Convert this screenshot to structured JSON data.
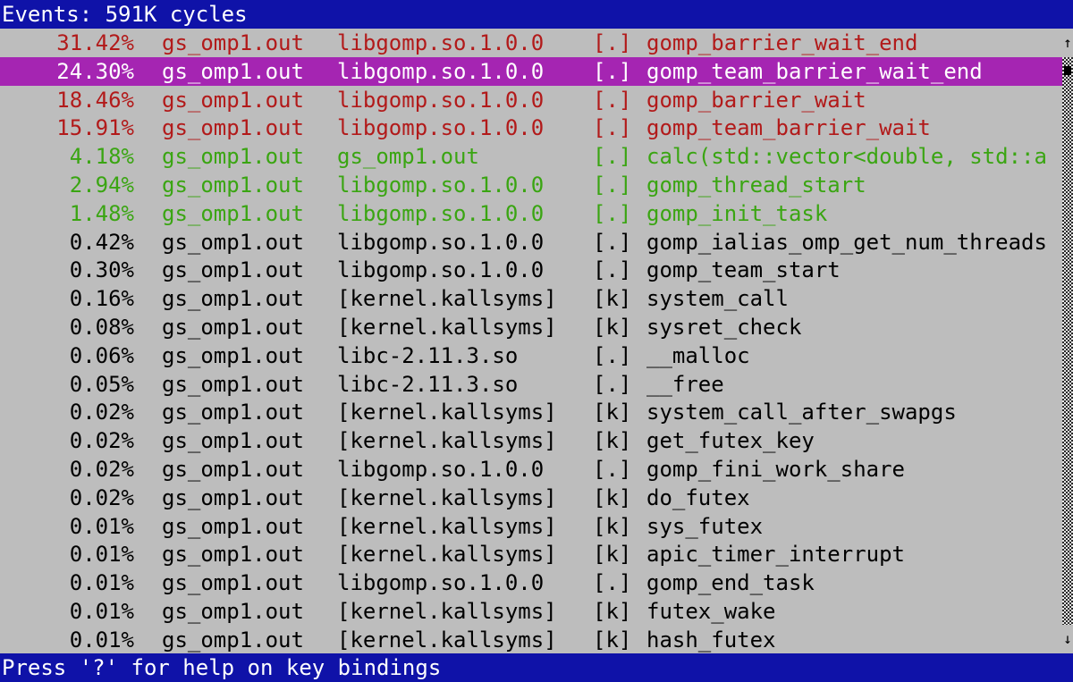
{
  "header": {
    "title": "Events: 591K cycles"
  },
  "footer": {
    "hint": "Press '?' for help on key bindings"
  },
  "colors": {
    "bar_bg": "#0f12a8",
    "selection_bg": "#a525b2",
    "hot": "#b21a1a",
    "warm": "#3aa512",
    "background": "#bdbdbd"
  },
  "scrollbar": {
    "up_icon": "↑",
    "down_icon": "↓"
  },
  "rows": [
    {
      "pct": "31.42%",
      "command": "gs_omp1.out",
      "dso": "libgomp.so.1.0.0",
      "level": "[.]",
      "symbol": "gomp_barrier_wait_end",
      "heat": "red",
      "selected": false
    },
    {
      "pct": "24.30%",
      "command": "gs_omp1.out",
      "dso": "libgomp.so.1.0.0",
      "level": "[.]",
      "symbol": "gomp_team_barrier_wait_end",
      "heat": "red",
      "selected": true
    },
    {
      "pct": "18.46%",
      "command": "gs_omp1.out",
      "dso": "libgomp.so.1.0.0",
      "level": "[.]",
      "symbol": "gomp_barrier_wait",
      "heat": "red",
      "selected": false
    },
    {
      "pct": "15.91%",
      "command": "gs_omp1.out",
      "dso": "libgomp.so.1.0.0",
      "level": "[.]",
      "symbol": "gomp_team_barrier_wait",
      "heat": "red",
      "selected": false
    },
    {
      "pct": "4.18%",
      "command": "gs_omp1.out",
      "dso": "gs_omp1.out",
      "level": "[.]",
      "symbol": "calc(std::vector<double, std::a",
      "heat": "green",
      "selected": false
    },
    {
      "pct": "2.94%",
      "command": "gs_omp1.out",
      "dso": "libgomp.so.1.0.0",
      "level": "[.]",
      "symbol": "gomp_thread_start",
      "heat": "green",
      "selected": false
    },
    {
      "pct": "1.48%",
      "command": "gs_omp1.out",
      "dso": "libgomp.so.1.0.0",
      "level": "[.]",
      "symbol": "gomp_init_task",
      "heat": "green",
      "selected": false
    },
    {
      "pct": "0.42%",
      "command": "gs_omp1.out",
      "dso": "libgomp.so.1.0.0",
      "level": "[.]",
      "symbol": "gomp_ialias_omp_get_num_threads",
      "heat": "none",
      "selected": false
    },
    {
      "pct": "0.30%",
      "command": "gs_omp1.out",
      "dso": "libgomp.so.1.0.0",
      "level": "[.]",
      "symbol": "gomp_team_start",
      "heat": "none",
      "selected": false
    },
    {
      "pct": "0.16%",
      "command": "gs_omp1.out",
      "dso": "[kernel.kallsyms]",
      "level": "[k]",
      "symbol": "system_call",
      "heat": "none",
      "selected": false
    },
    {
      "pct": "0.08%",
      "command": "gs_omp1.out",
      "dso": "[kernel.kallsyms]",
      "level": "[k]",
      "symbol": "sysret_check",
      "heat": "none",
      "selected": false
    },
    {
      "pct": "0.06%",
      "command": "gs_omp1.out",
      "dso": "libc-2.11.3.so",
      "level": "[.]",
      "symbol": "__malloc",
      "heat": "none",
      "selected": false
    },
    {
      "pct": "0.05%",
      "command": "gs_omp1.out",
      "dso": "libc-2.11.3.so",
      "level": "[.]",
      "symbol": "__free",
      "heat": "none",
      "selected": false
    },
    {
      "pct": "0.02%",
      "command": "gs_omp1.out",
      "dso": "[kernel.kallsyms]",
      "level": "[k]",
      "symbol": "system_call_after_swapgs",
      "heat": "none",
      "selected": false
    },
    {
      "pct": "0.02%",
      "command": "gs_omp1.out",
      "dso": "[kernel.kallsyms]",
      "level": "[k]",
      "symbol": "get_futex_key",
      "heat": "none",
      "selected": false
    },
    {
      "pct": "0.02%",
      "command": "gs_omp1.out",
      "dso": "libgomp.so.1.0.0",
      "level": "[.]",
      "symbol": "gomp_fini_work_share",
      "heat": "none",
      "selected": false
    },
    {
      "pct": "0.02%",
      "command": "gs_omp1.out",
      "dso": "[kernel.kallsyms]",
      "level": "[k]",
      "symbol": "do_futex",
      "heat": "none",
      "selected": false
    },
    {
      "pct": "0.01%",
      "command": "gs_omp1.out",
      "dso": "[kernel.kallsyms]",
      "level": "[k]",
      "symbol": "sys_futex",
      "heat": "none",
      "selected": false
    },
    {
      "pct": "0.01%",
      "command": "gs_omp1.out",
      "dso": "[kernel.kallsyms]",
      "level": "[k]",
      "symbol": "apic_timer_interrupt",
      "heat": "none",
      "selected": false
    },
    {
      "pct": "0.01%",
      "command": "gs_omp1.out",
      "dso": "libgomp.so.1.0.0",
      "level": "[.]",
      "symbol": "gomp_end_task",
      "heat": "none",
      "selected": false
    },
    {
      "pct": "0.01%",
      "command": "gs_omp1.out",
      "dso": "[kernel.kallsyms]",
      "level": "[k]",
      "symbol": "futex_wake",
      "heat": "none",
      "selected": false
    },
    {
      "pct": "0.01%",
      "command": "gs_omp1.out",
      "dso": "[kernel.kallsyms]",
      "level": "[k]",
      "symbol": "hash_futex",
      "heat": "none",
      "selected": false
    }
  ]
}
